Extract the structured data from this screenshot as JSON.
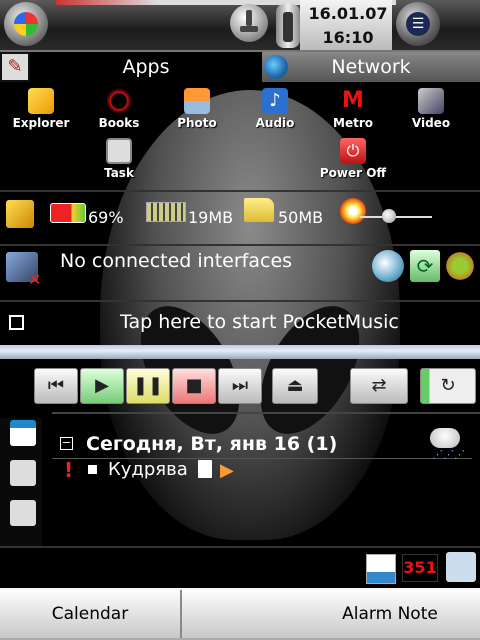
{
  "status": {
    "date": "16.01.07",
    "time": "16:10"
  },
  "tabs": {
    "apps": "Apps",
    "network": "Network"
  },
  "apps": [
    {
      "label": "Explorer",
      "icon": "explorer-icon"
    },
    {
      "label": "Books",
      "icon": "books-icon"
    },
    {
      "label": "Photo",
      "icon": "photo-icon"
    },
    {
      "label": "Audio",
      "icon": "audio-icon"
    },
    {
      "label": "Metro",
      "icon": "metro-icon"
    },
    {
      "label": "Video",
      "icon": "video-icon"
    },
    {
      "label": "Task",
      "icon": "task-icon"
    },
    {
      "label": "Power Off",
      "icon": "power-off-icon"
    }
  ],
  "system": {
    "battery": "69%",
    "memory": "19MB",
    "storage": "50MB",
    "brightness_level": 0.4
  },
  "network": {
    "status": "No connected interfaces"
  },
  "music": {
    "prompt": "Tap here to start PocketMusic"
  },
  "calendar": {
    "heading": "Сегодня, Вт, янв 16 (1)",
    "items": [
      "Кудрява"
    ]
  },
  "tray": {
    "badge_count": "351"
  },
  "softkeys": {
    "left": "Calendar",
    "right": "Alarm Note"
  }
}
